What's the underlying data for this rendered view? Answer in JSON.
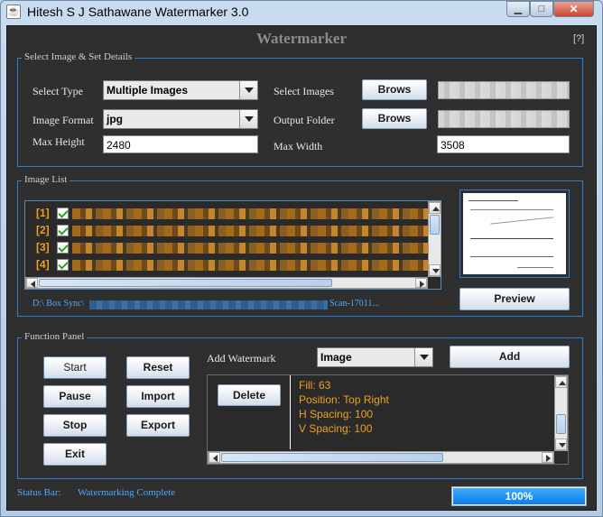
{
  "window": {
    "title": "Hitesh S J Sathawane Watermarker 3.0",
    "app_icon_glyph": "☕",
    "min_glyph": "▁",
    "max_glyph": "□",
    "close_glyph": "✕"
  },
  "header": {
    "title": "Watermarker",
    "help": "[?]"
  },
  "select_panel": {
    "legend": "Select Image & Set Details",
    "select_type_label": "Select Type",
    "select_type_value": "Multiple Images",
    "image_format_label": "Image Format",
    "image_format_value": "jpg",
    "max_height_label": "Max Height",
    "max_height_value": "2480",
    "select_images_label": "Select Images",
    "output_folder_label": "Output Folder",
    "max_width_label": "Max Width",
    "max_width_value": "3508",
    "brows_label": "Brows"
  },
  "image_list": {
    "legend": "Image List",
    "rows": [
      "[1]",
      "[2]",
      "[3]",
      "[4]"
    ],
    "path_prefix": "D:\\ Box Sync\\",
    "path_suffix": "Scan-17011...",
    "preview_button": "Preview"
  },
  "function_panel": {
    "legend": "Function Panel",
    "start": "Start",
    "pause": "Pause",
    "stop": "Stop",
    "exit": "Exit",
    "reset": "Reset",
    "import": "Import",
    "export": "Export",
    "add_watermark_label": "Add Watermark",
    "watermark_type": "Image",
    "add": "Add",
    "delete": "Delete",
    "info_lines": [
      "Fill: 63",
      "Position: Top Right",
      "H Spacing: 100",
      "V Spacing: 100"
    ]
  },
  "status": {
    "label": "Status Bar:",
    "message": "Watermarking Complete",
    "progress_text": "100%",
    "progress_fraction": 1.0
  },
  "colors": {
    "accent": "#2b7fd4",
    "background": "#2f2f2f",
    "orange": "#f0a020",
    "link": "#4fa8ff"
  }
}
